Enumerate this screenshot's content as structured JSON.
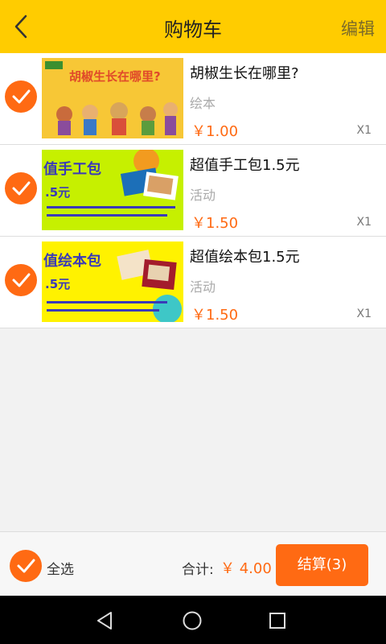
{
  "header": {
    "back_icon": "chevron-left-icon",
    "title": "购物车",
    "edit_label": "编辑"
  },
  "items": [
    {
      "name": "胡椒生长在哪里?",
      "tag": "绘本",
      "price": "￥1.00",
      "qty": "X1",
      "checked": true,
      "thumb": {
        "headline": "胡椒生长在哪里?"
      }
    },
    {
      "name": "超值手工包1.5元",
      "tag": "活动",
      "price": "￥1.50",
      "qty": "X1",
      "checked": true,
      "thumb": {
        "headline": "值手工包",
        "sub": ".5元"
      }
    },
    {
      "name": "超值绘本包1.5元",
      "tag": "活动",
      "price": "￥1.50",
      "qty": "X1",
      "checked": true,
      "thumb": {
        "headline": "值绘本包",
        "sub": ".5元"
      }
    }
  ],
  "footer": {
    "select_all_label": "全选",
    "select_all_checked": true,
    "total_label": "合计:",
    "total_value": "￥ 4.00",
    "checkout_label": "结算(3)"
  },
  "navbar": {
    "back_icon": "triangle-back-icon",
    "home_icon": "circle-home-icon",
    "recent_icon": "square-recent-icon"
  },
  "colors": {
    "header_bg": "#ffcc00",
    "accent": "#ff6a13"
  }
}
